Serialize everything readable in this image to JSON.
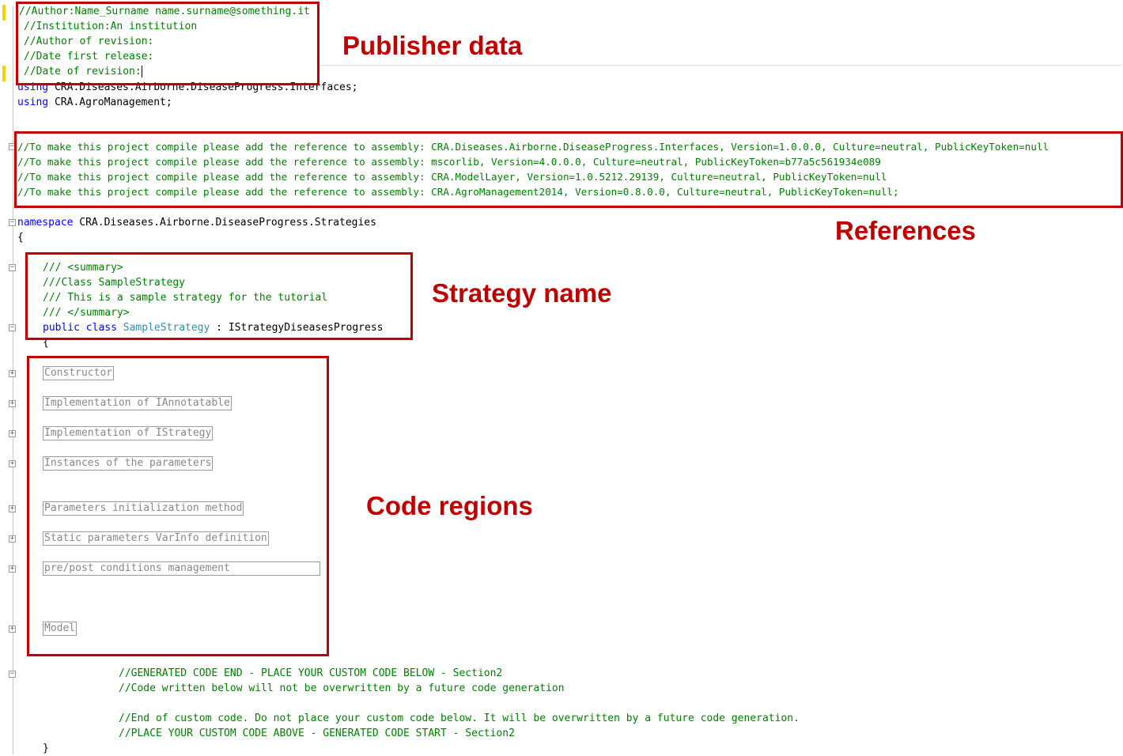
{
  "header_comments": [
    "//Author:Name_Surname name.surname@something.it",
    "//Institution:An institution",
    "//Author of revision:",
    "//Date first release:",
    "//Date of revision:"
  ],
  "usings": [
    {
      "keyword": "using",
      "name": "CRA.Diseases.Airborne.DiseaseProgress.Interfaces;"
    },
    {
      "keyword": "using",
      "name": "CRA.AgroManagement;"
    }
  ],
  "reference_comments": [
    "//To make this project compile please add the reference to assembly: CRA.Diseases.Airborne.DiseaseProgress.Interfaces, Version=1.0.0.0, Culture=neutral, PublicKeyToken=null",
    "//To make this project compile please add the reference to assembly: mscorlib, Version=4.0.0.0, Culture=neutral, PublicKeyToken=b77a5c561934e089",
    "//To make this project compile please add the reference to assembly: CRA.ModelLayer, Version=1.0.5212.29139, Culture=neutral, PublicKeyToken=null",
    "//To make this project compile please add the reference to assembly: CRA.AgroManagement2014, Version=0.8.0.0, Culture=neutral, PublicKeyToken=null;"
  ],
  "namespace": {
    "keyword": "namespace",
    "name": "CRA.Diseases.Airborne.DiseaseProgress.Strategies",
    "open_brace": "{",
    "close_brace": "}"
  },
  "summary_comments": [
    "/// <summary>",
    "///Class SampleStrategy",
    "/// This is a sample strategy for the tutorial",
    "/// </summary>"
  ],
  "class_decl": {
    "kw1": "public",
    "kw2": "class",
    "name": "SampleStrategy",
    "rest": " : IStrategyDiseasesProgress",
    "open_brace": "{"
  },
  "regions": [
    "Constructor",
    "Implementation of IAnnotatable",
    "Implementation of IStrategy",
    "Instances of the parameters",
    "Parameters initialization method",
    "Static parameters VarInfo definition",
    "pre/post conditions management",
    "Model"
  ],
  "custom_code_comments": [
    "//GENERATED CODE END - PLACE YOUR CUSTOM CODE BELOW - Section2",
    "//Code written below will not be overwritten by a future code generation",
    "//End of custom code. Do not place your custom code below. It will be overwritten by a future code generation.",
    "//PLACE YOUR CUSTOM CODE ABOVE - GENERATED CODE START - Section2"
  ],
  "callouts": {
    "publisher": "Publisher data",
    "references": "References",
    "strategy": "Strategy name",
    "regions": "Code regions"
  },
  "colors": {
    "callout": "#c00000",
    "comment": "#008000",
    "keyword": "#0000ff",
    "type": "#2b91af",
    "change_bar": "#f2d400"
  },
  "icons": {
    "collapse": "minus-box-icon",
    "expand": "plus-box-icon"
  }
}
